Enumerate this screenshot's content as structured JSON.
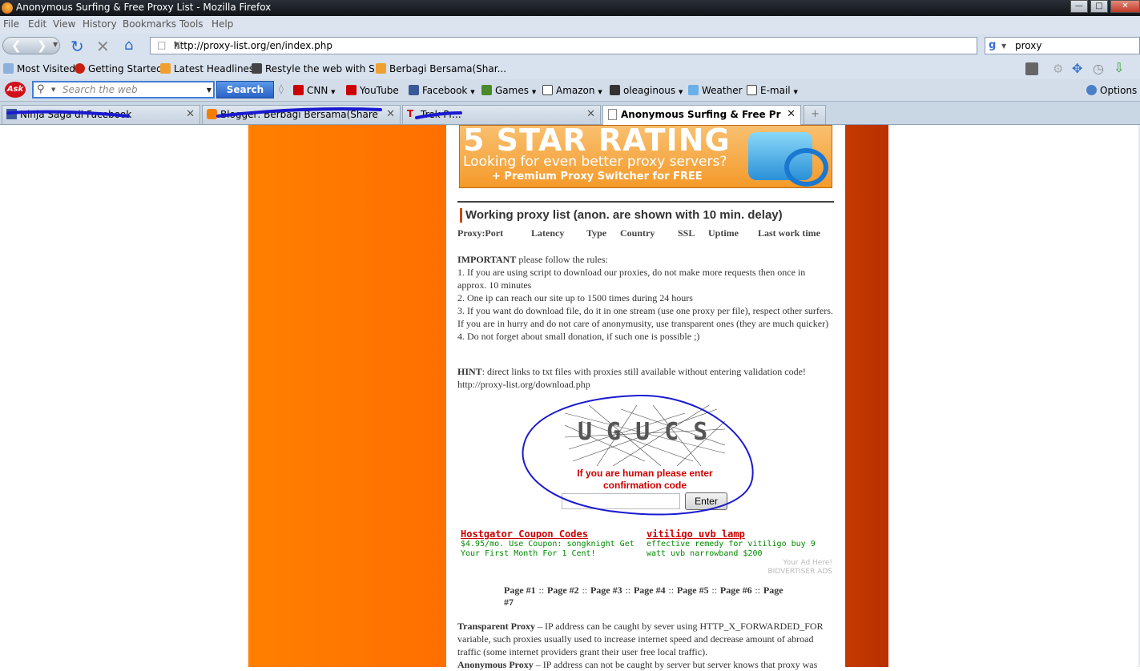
{
  "window": {
    "title": "Anonymous Surfing & Free Proxy List - Mozilla Firefox"
  },
  "menu": [
    "File",
    "Edit",
    "View",
    "History",
    "Bookmarks",
    "Tools",
    "Help"
  ],
  "nav": {
    "url": "http://proxy-list.org/en/index.php",
    "search_query": "proxy"
  },
  "bookmarks": [
    "Most Visited",
    "Getting Started",
    "Latest Headlines",
    "Restyle the web with S...",
    "Berbagi Bersama(Shar..."
  ],
  "ask_toolbar": {
    "search_placeholder": "Search the web",
    "search_button": "Search",
    "items": [
      "CNN",
      "YouTube",
      "Facebook",
      "Games",
      "Amazon",
      "oleaginous",
      "Weather",
      "E-mail"
    ],
    "options": "Options"
  },
  "tabs": [
    {
      "label": "Ninja Saga di Facebook"
    },
    {
      "label": "Blogger: Berbagi Bersama(Share Yo..."
    },
    {
      "label": "Trek Pr..."
    },
    {
      "label": "Anonymous Surfing & Free Proxy..."
    }
  ],
  "page": {
    "banner": {
      "line1": "5 STAR RATING",
      "line2": "Looking for even better proxy servers?",
      "line3": "+ Premium Proxy Switcher for FREE"
    },
    "heading": "Working proxy list (anon. are shown with 10 min. delay)",
    "columns": [
      "Proxy:Port",
      "Latency",
      "Type",
      "Country",
      "SSL",
      "Uptime",
      "Last work time"
    ],
    "important_label": "IMPORTANT",
    "important_intro": " please follow the rules:",
    "rules": [
      "1. If you are using script to download our proxies, do not make more requests then once in approx. 10 minutes",
      "2. One ip can reach our site up to 1500 times during 24 hours",
      "3. If you want do download file, do it in one stream (use one proxy per file), respect other surfers. If you are in hurry and do not care of anonymusity, use transparent ones (they are much quicker)",
      "4. Do not forget about small donation, if such one is possible ;)"
    ],
    "hint_label": "HINT",
    "hint_text": ": direct links to txt files with proxies still available without entering validation code!",
    "hint_url": "http://proxy-list.org/download.php",
    "captcha_text": "UGUCS",
    "captcha_prompt": "If you are human please enter confirmation code",
    "enter_button": "Enter",
    "ads": [
      {
        "title": "Hostgator Coupon Codes",
        "desc": "$4.95/mo. Use Coupon: songknight Get Your First Month For 1 Cent!"
      },
      {
        "title": "vitiligo uvb lamp",
        "desc": "effective remedy for vitiligo buy 9 watt uvb narrowband $200"
      }
    ],
    "ad_here": "Your Ad Here!",
    "ad_network": "BIDVERTISER ADS",
    "pages": [
      "Page #1",
      "Page #2",
      "Page #3",
      "Page #4",
      "Page #5",
      "Page #6",
      "Page #7"
    ],
    "transparent_label": "Transparent Proxy",
    "transparent_text": " – IP address can be caught by sever using HTTP_X_FORWARDED_FOR variable, such proxies usually used to increase internet speed and decrease amount of abroad traffic (some internet providers grant their user free local traffic).",
    "anonymous_label": "Anonymous Proxy",
    "anonymous_text": " – IP address can not be caught by server but server knows that proxy was"
  },
  "colors": {
    "accent_orange": "#ff7f00",
    "annotation_blue": "#1a1ad0",
    "captcha_red": "#d00000"
  }
}
